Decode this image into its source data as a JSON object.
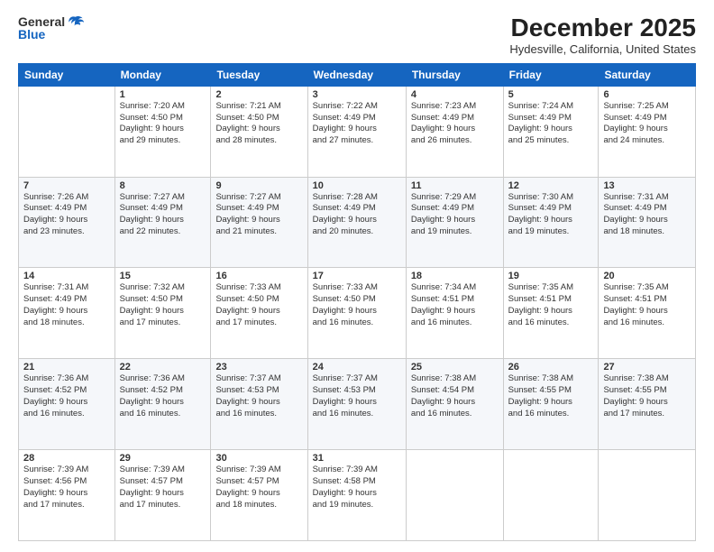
{
  "header": {
    "logo": {
      "general": "General",
      "blue": "Blue"
    },
    "title": "December 2025",
    "location": "Hydesville, California, United States"
  },
  "calendar": {
    "days_of_week": [
      "Sunday",
      "Monday",
      "Tuesday",
      "Wednesday",
      "Thursday",
      "Friday",
      "Saturday"
    ],
    "weeks": [
      [
        {
          "day": "",
          "info": ""
        },
        {
          "day": "1",
          "info": "Sunrise: 7:20 AM\nSunset: 4:50 PM\nDaylight: 9 hours\nand 29 minutes."
        },
        {
          "day": "2",
          "info": "Sunrise: 7:21 AM\nSunset: 4:50 PM\nDaylight: 9 hours\nand 28 minutes."
        },
        {
          "day": "3",
          "info": "Sunrise: 7:22 AM\nSunset: 4:49 PM\nDaylight: 9 hours\nand 27 minutes."
        },
        {
          "day": "4",
          "info": "Sunrise: 7:23 AM\nSunset: 4:49 PM\nDaylight: 9 hours\nand 26 minutes."
        },
        {
          "day": "5",
          "info": "Sunrise: 7:24 AM\nSunset: 4:49 PM\nDaylight: 9 hours\nand 25 minutes."
        },
        {
          "day": "6",
          "info": "Sunrise: 7:25 AM\nSunset: 4:49 PM\nDaylight: 9 hours\nand 24 minutes."
        }
      ],
      [
        {
          "day": "7",
          "info": "Sunrise: 7:26 AM\nSunset: 4:49 PM\nDaylight: 9 hours\nand 23 minutes."
        },
        {
          "day": "8",
          "info": "Sunrise: 7:27 AM\nSunset: 4:49 PM\nDaylight: 9 hours\nand 22 minutes."
        },
        {
          "day": "9",
          "info": "Sunrise: 7:27 AM\nSunset: 4:49 PM\nDaylight: 9 hours\nand 21 minutes."
        },
        {
          "day": "10",
          "info": "Sunrise: 7:28 AM\nSunset: 4:49 PM\nDaylight: 9 hours\nand 20 minutes."
        },
        {
          "day": "11",
          "info": "Sunrise: 7:29 AM\nSunset: 4:49 PM\nDaylight: 9 hours\nand 19 minutes."
        },
        {
          "day": "12",
          "info": "Sunrise: 7:30 AM\nSunset: 4:49 PM\nDaylight: 9 hours\nand 19 minutes."
        },
        {
          "day": "13",
          "info": "Sunrise: 7:31 AM\nSunset: 4:49 PM\nDaylight: 9 hours\nand 18 minutes."
        }
      ],
      [
        {
          "day": "14",
          "info": "Sunrise: 7:31 AM\nSunset: 4:49 PM\nDaylight: 9 hours\nand 18 minutes."
        },
        {
          "day": "15",
          "info": "Sunrise: 7:32 AM\nSunset: 4:50 PM\nDaylight: 9 hours\nand 17 minutes."
        },
        {
          "day": "16",
          "info": "Sunrise: 7:33 AM\nSunset: 4:50 PM\nDaylight: 9 hours\nand 17 minutes."
        },
        {
          "day": "17",
          "info": "Sunrise: 7:33 AM\nSunset: 4:50 PM\nDaylight: 9 hours\nand 16 minutes."
        },
        {
          "day": "18",
          "info": "Sunrise: 7:34 AM\nSunset: 4:51 PM\nDaylight: 9 hours\nand 16 minutes."
        },
        {
          "day": "19",
          "info": "Sunrise: 7:35 AM\nSunset: 4:51 PM\nDaylight: 9 hours\nand 16 minutes."
        },
        {
          "day": "20",
          "info": "Sunrise: 7:35 AM\nSunset: 4:51 PM\nDaylight: 9 hours\nand 16 minutes."
        }
      ],
      [
        {
          "day": "21",
          "info": "Sunrise: 7:36 AM\nSunset: 4:52 PM\nDaylight: 9 hours\nand 16 minutes."
        },
        {
          "day": "22",
          "info": "Sunrise: 7:36 AM\nSunset: 4:52 PM\nDaylight: 9 hours\nand 16 minutes."
        },
        {
          "day": "23",
          "info": "Sunrise: 7:37 AM\nSunset: 4:53 PM\nDaylight: 9 hours\nand 16 minutes."
        },
        {
          "day": "24",
          "info": "Sunrise: 7:37 AM\nSunset: 4:53 PM\nDaylight: 9 hours\nand 16 minutes."
        },
        {
          "day": "25",
          "info": "Sunrise: 7:38 AM\nSunset: 4:54 PM\nDaylight: 9 hours\nand 16 minutes."
        },
        {
          "day": "26",
          "info": "Sunrise: 7:38 AM\nSunset: 4:55 PM\nDaylight: 9 hours\nand 16 minutes."
        },
        {
          "day": "27",
          "info": "Sunrise: 7:38 AM\nSunset: 4:55 PM\nDaylight: 9 hours\nand 17 minutes."
        }
      ],
      [
        {
          "day": "28",
          "info": "Sunrise: 7:39 AM\nSunset: 4:56 PM\nDaylight: 9 hours\nand 17 minutes."
        },
        {
          "day": "29",
          "info": "Sunrise: 7:39 AM\nSunset: 4:57 PM\nDaylight: 9 hours\nand 17 minutes."
        },
        {
          "day": "30",
          "info": "Sunrise: 7:39 AM\nSunset: 4:57 PM\nDaylight: 9 hours\nand 18 minutes."
        },
        {
          "day": "31",
          "info": "Sunrise: 7:39 AM\nSunset: 4:58 PM\nDaylight: 9 hours\nand 19 minutes."
        },
        {
          "day": "",
          "info": ""
        },
        {
          "day": "",
          "info": ""
        },
        {
          "day": "",
          "info": ""
        }
      ]
    ]
  }
}
